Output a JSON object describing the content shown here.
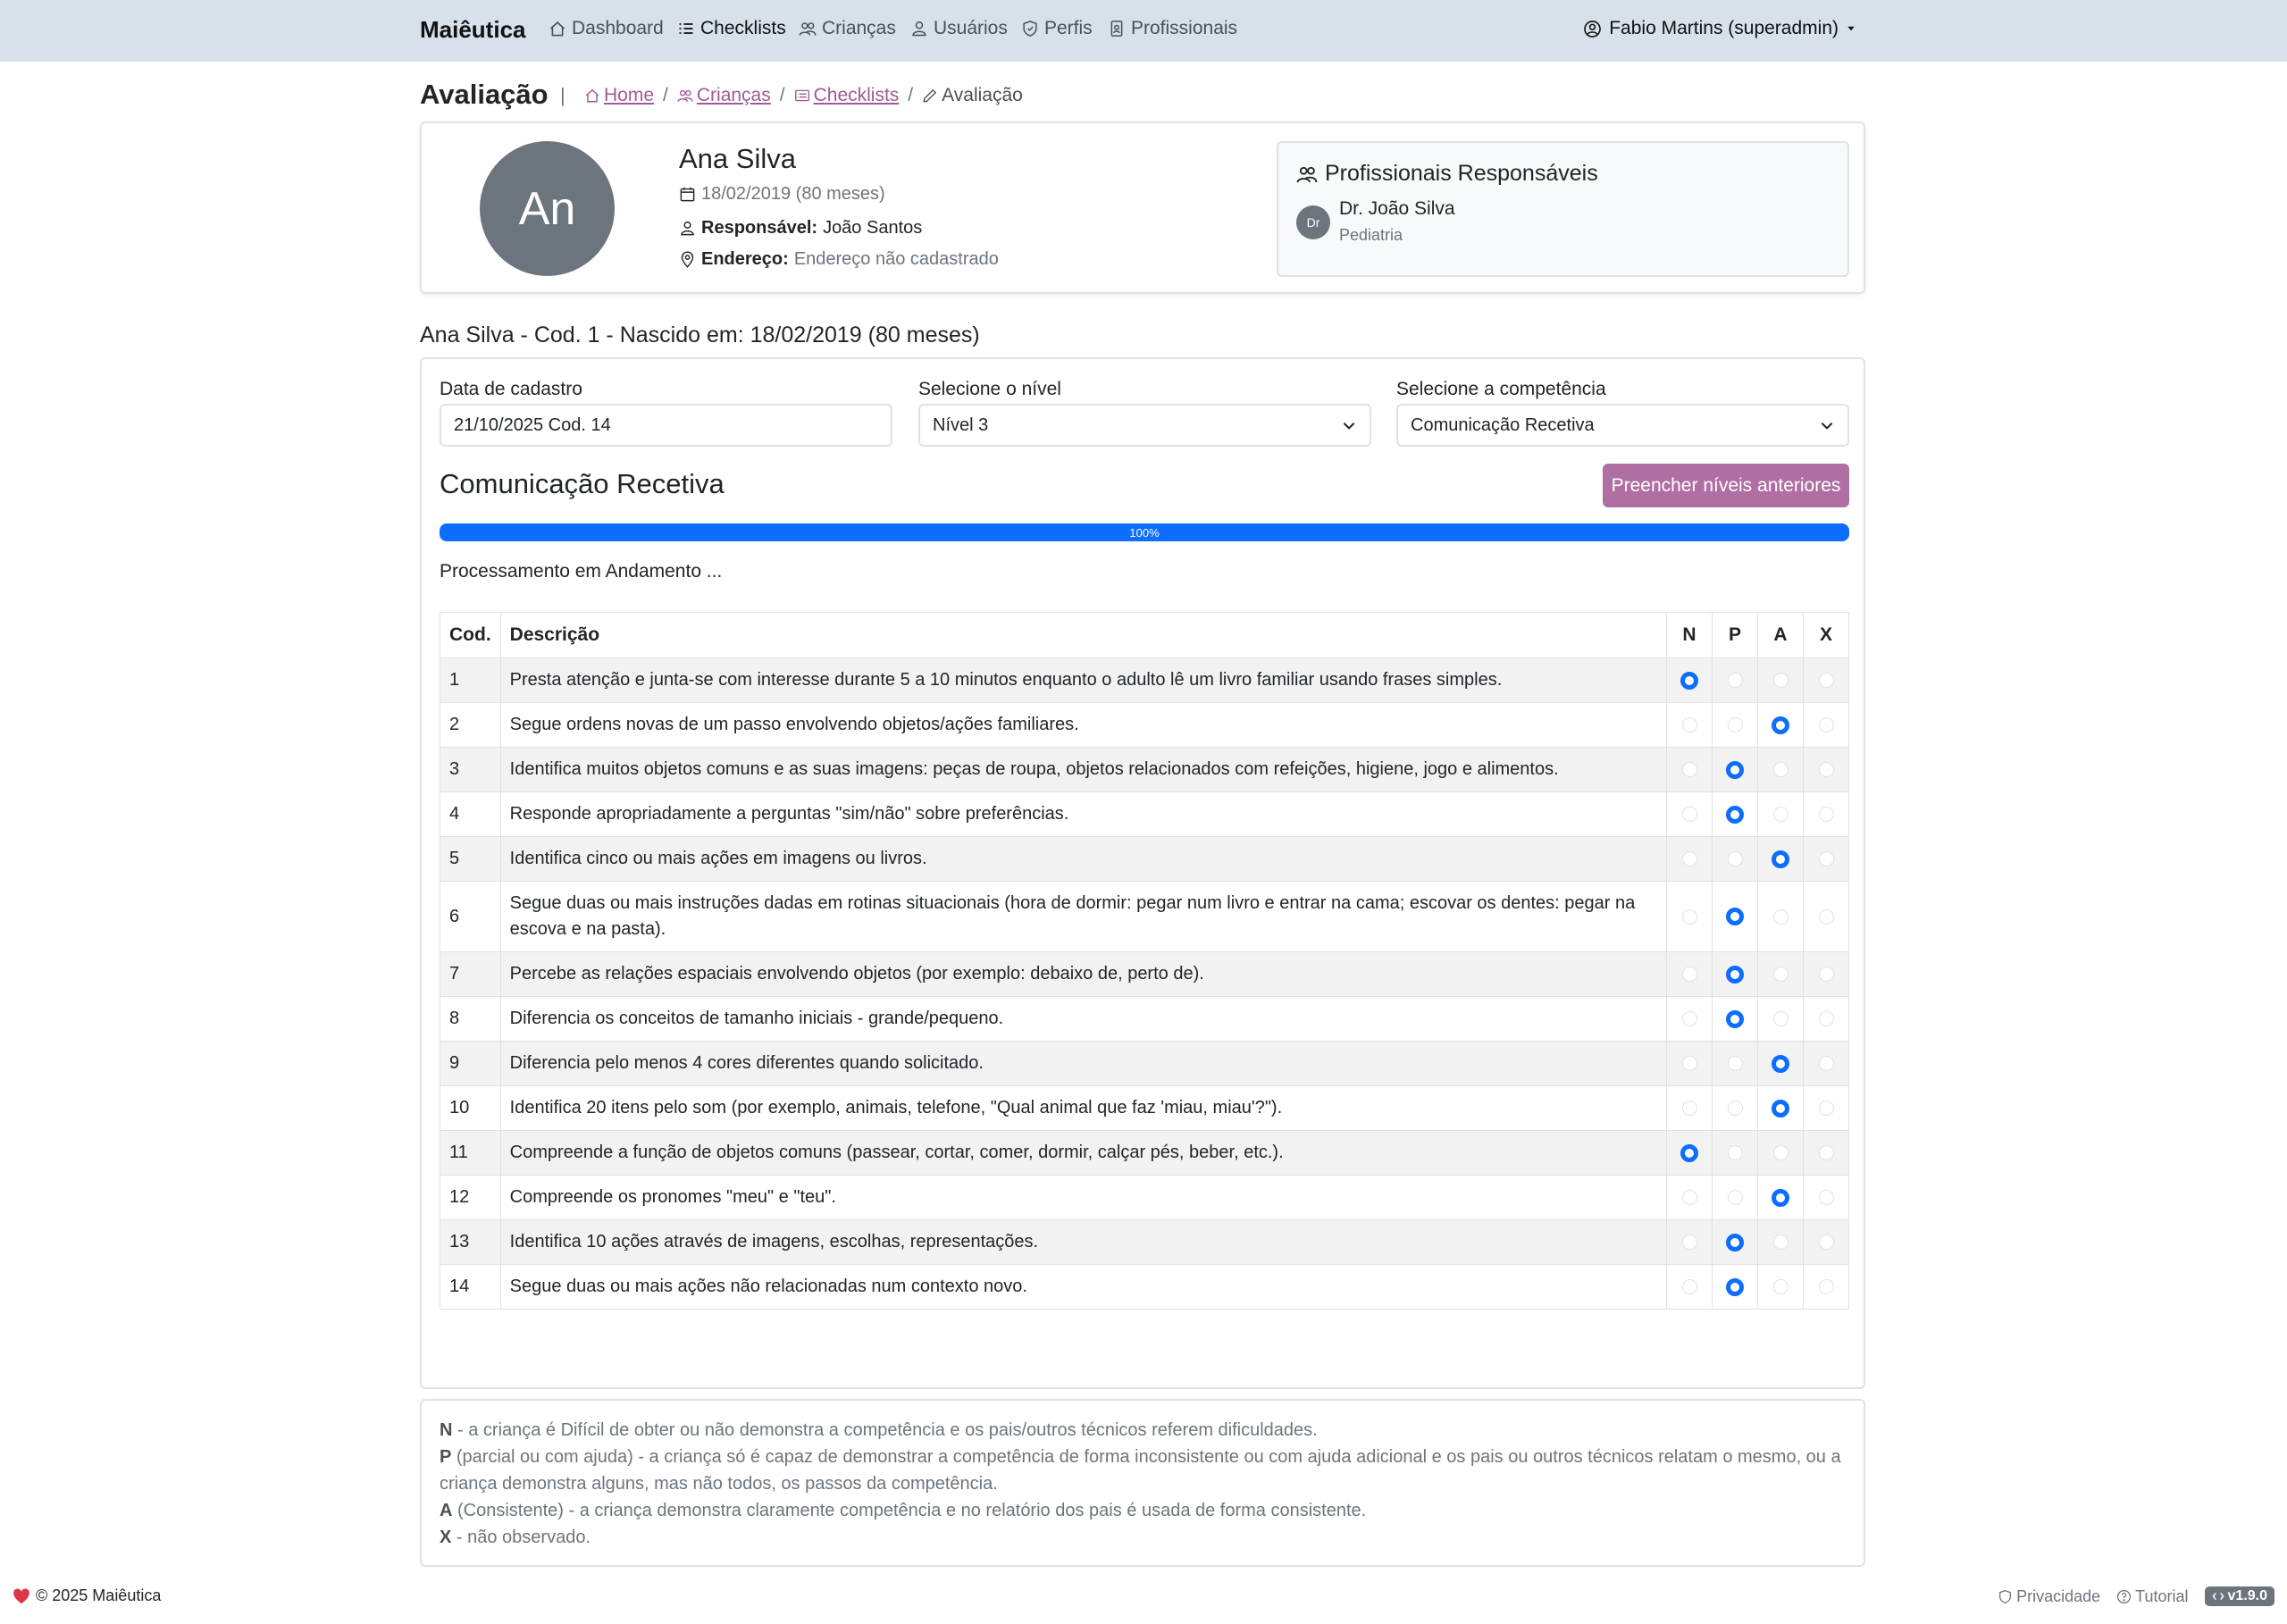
{
  "nav": {
    "brand": "Maiêutica",
    "items": [
      {
        "label": "Dashboard",
        "icon": "house-icon",
        "active": false
      },
      {
        "label": "Checklists",
        "icon": "list-check-icon",
        "active": true
      },
      {
        "label": "Crianças",
        "icon": "people-icon",
        "active": false
      },
      {
        "label": "Usuários",
        "icon": "person-icon",
        "active": false
      },
      {
        "label": "Perfis",
        "icon": "shield-icon",
        "active": false
      },
      {
        "label": "Profissionais",
        "icon": "badge-icon",
        "active": false
      }
    ],
    "user": "Fabio Martins (superadmin)"
  },
  "page": {
    "title": "Avaliação",
    "breadcrumb": [
      "Home",
      "Crianças",
      "Checklists"
    ],
    "breadcrumb_current": "Avaliação"
  },
  "child": {
    "initials": "An",
    "name": "Ana Silva",
    "birth": "18/02/2019 (80 meses)",
    "responsible_label": "Responsável:",
    "responsible": "João Santos",
    "address_label": "Endereço:",
    "address": "Endereço não cadastrado"
  },
  "professionals": {
    "title": "Profissionais Responsáveis",
    "items": [
      {
        "initials": "Dr",
        "name": "Dr. João Silva",
        "specialty": "Pediatria"
      }
    ]
  },
  "summary": "Ana Silva - Cod. 1 - Nascido em: 18/02/2019 (80 meses)",
  "form": {
    "date_label": "Data de cadastro",
    "date_value": "21/10/2025 Cod. 14",
    "level_label": "Selecione o nível",
    "level_value": "Nível 3",
    "competence_label": "Selecione a competência",
    "competence_value": "Comunicação Recetiva"
  },
  "competence_title": "Comunicação Recetiva",
  "fill_button": "Preencher níveis anteriores",
  "progress": {
    "percent": 100,
    "label": "100%"
  },
  "processing": "Processamento em Andamento ...",
  "table": {
    "headers": {
      "cod": "Cod.",
      "desc": "Descrição",
      "n": "N",
      "p": "P",
      "a": "A",
      "x": "X"
    },
    "rows": [
      {
        "cod": "1",
        "desc": "Presta atenção e junta-se com interesse durante 5 a 10 minutos enquanto o adulto lê um livro familiar usando frases simples.",
        "selected": "N"
      },
      {
        "cod": "2",
        "desc": "Segue ordens novas de um passo envolvendo objetos/ações familiares.",
        "selected": "A"
      },
      {
        "cod": "3",
        "desc": "Identifica muitos objetos comuns e as suas imagens: peças de roupa, objetos relacionados com refeições, higiene, jogo e alimentos.",
        "selected": "P"
      },
      {
        "cod": "4",
        "desc": "Responde apropriadamente a perguntas \"sim/não\" sobre preferências.",
        "selected": "P"
      },
      {
        "cod": "5",
        "desc": "Identifica cinco ou mais ações em imagens ou livros.",
        "selected": "A"
      },
      {
        "cod": "6",
        "desc": "Segue duas ou mais instruções dadas em rotinas situacionais (hora de dormir: pegar num livro e entrar na cama; escovar os dentes: pegar na escova e na pasta).",
        "selected": "P"
      },
      {
        "cod": "7",
        "desc": "Percebe as relações espaciais envolvendo objetos (por exemplo: debaixo de, perto de).",
        "selected": "P"
      },
      {
        "cod": "8",
        "desc": "Diferencia os conceitos de tamanho iniciais - grande/pequeno.",
        "selected": "P"
      },
      {
        "cod": "9",
        "desc": "Diferencia pelo menos 4 cores diferentes quando solicitado.",
        "selected": "A"
      },
      {
        "cod": "10",
        "desc": "Identifica 20 itens pelo som (por exemplo, animais, telefone, \"Qual animal que faz 'miau, miau'?\").",
        "selected": "A"
      },
      {
        "cod": "11",
        "desc": "Compreende a função de objetos comuns (passear, cortar, comer, dormir, calçar pés, beber, etc.).",
        "selected": "N"
      },
      {
        "cod": "12",
        "desc": "Compreende os pronomes \"meu\" e \"teu\".",
        "selected": "A"
      },
      {
        "cod": "13",
        "desc": "Identifica 10 ações através de imagens, escolhas, representações.",
        "selected": "P"
      },
      {
        "cod": "14",
        "desc": "Segue duas ou mais ações não relacionadas num contexto novo.",
        "selected": "P"
      }
    ]
  },
  "legend": [
    {
      "key": "N",
      "text": " - a criança é Difícil de obter ou não demonstra a competência e os pais/outros técnicos referem dificuldades."
    },
    {
      "key": "P",
      "text": " (parcial ou com ajuda) - a criança só é capaz de demonstrar a competência de forma inconsistente ou com ajuda adicional e os pais ou outros técnicos relatam o mesmo, ou a criança demonstra alguns, mas não todos, os passos da competência."
    },
    {
      "key": "A",
      "text": " (Consistente) - a criança demonstra claramente competência e no relatório dos pais é usada de forma consistente."
    },
    {
      "key": "X",
      "text": " - não observado."
    }
  ],
  "footer": {
    "copyright": "© 2025 Maiêutica",
    "privacy": "Privacidade",
    "tutorial": "Tutorial",
    "version": "v1.9.0"
  },
  "colors": {
    "primary": "#0d6efd",
    "accent": "#b06fa2",
    "navbar": "#d6e1ea",
    "link": "#a15a94"
  }
}
